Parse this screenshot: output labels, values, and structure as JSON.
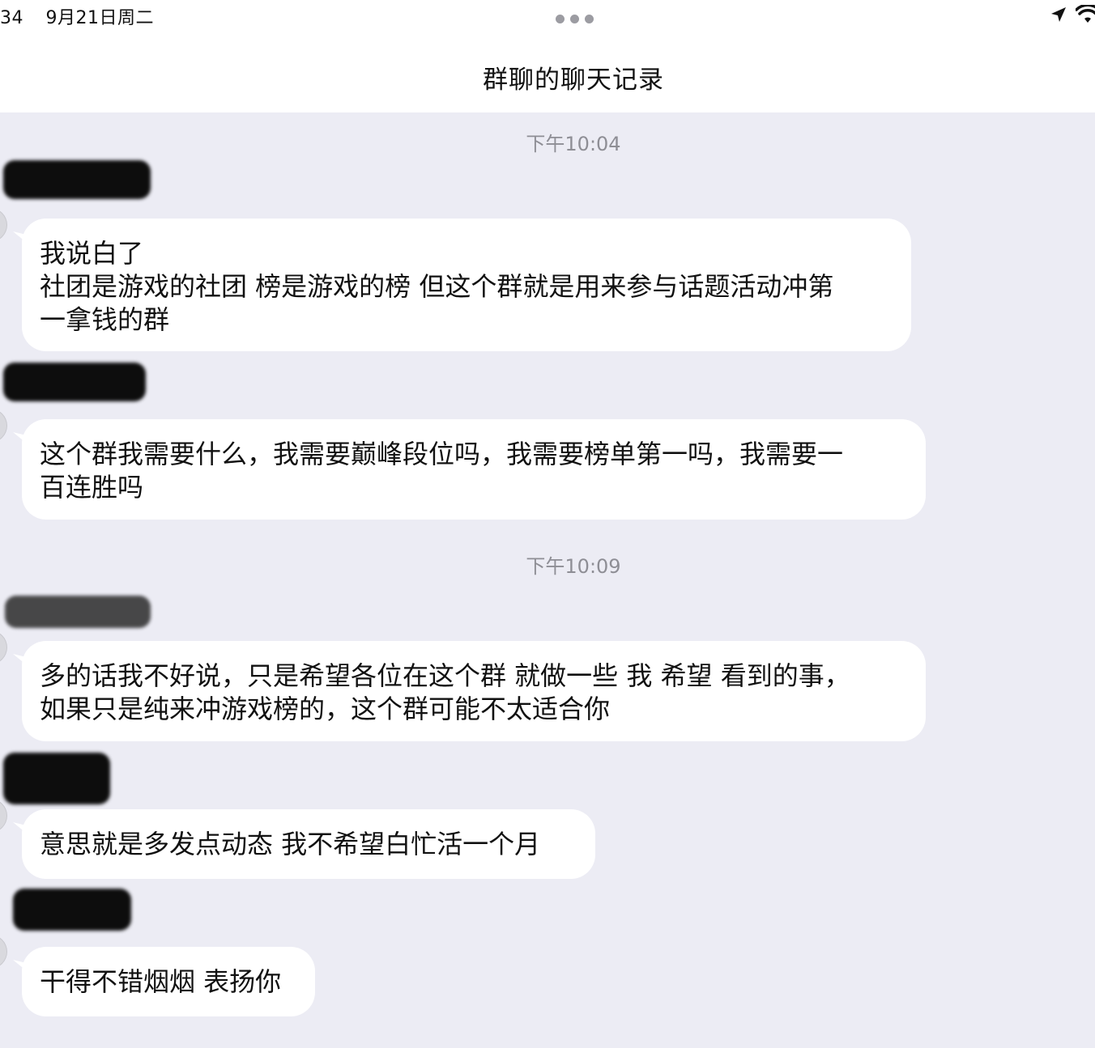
{
  "status_bar": {
    "time": "34",
    "date": "9月21日周二",
    "location_icon": "location-arrow-icon",
    "wifi_icon": "wifi-icon",
    "more_icon": "more-dots-icon"
  },
  "nav": {
    "title": "群聊的聊天记录"
  },
  "chat": {
    "timestamps": [
      "下午10:04",
      "下午10:09"
    ],
    "messages": [
      {
        "lines": [
          "我说白了",
          "社团是游戏的社团 榜是游戏的榜 但这个群就是用来参与话题活动冲第",
          "一拿钱的群"
        ]
      },
      {
        "lines": [
          "这个群我需要什么，我需要巅峰段位吗，我需要榜单第一吗，我需要一",
          "百连胜吗"
        ]
      },
      {
        "lines": [
          "多的话我不好说，只是希望各位在这个群 就做一些 我 希望 看到的事，",
          "如果只是纯来冲游戏榜的，这个群可能不太适合你"
        ]
      },
      {
        "lines": [
          "意思就是多发点动态 我不希望白忙活一个月"
        ]
      },
      {
        "lines": [
          "干得不错烟烟 表扬你"
        ]
      }
    ]
  },
  "colors": {
    "background": "#ececf4",
    "bubble": "#ffffff",
    "timestamp": "#8e8e95"
  }
}
